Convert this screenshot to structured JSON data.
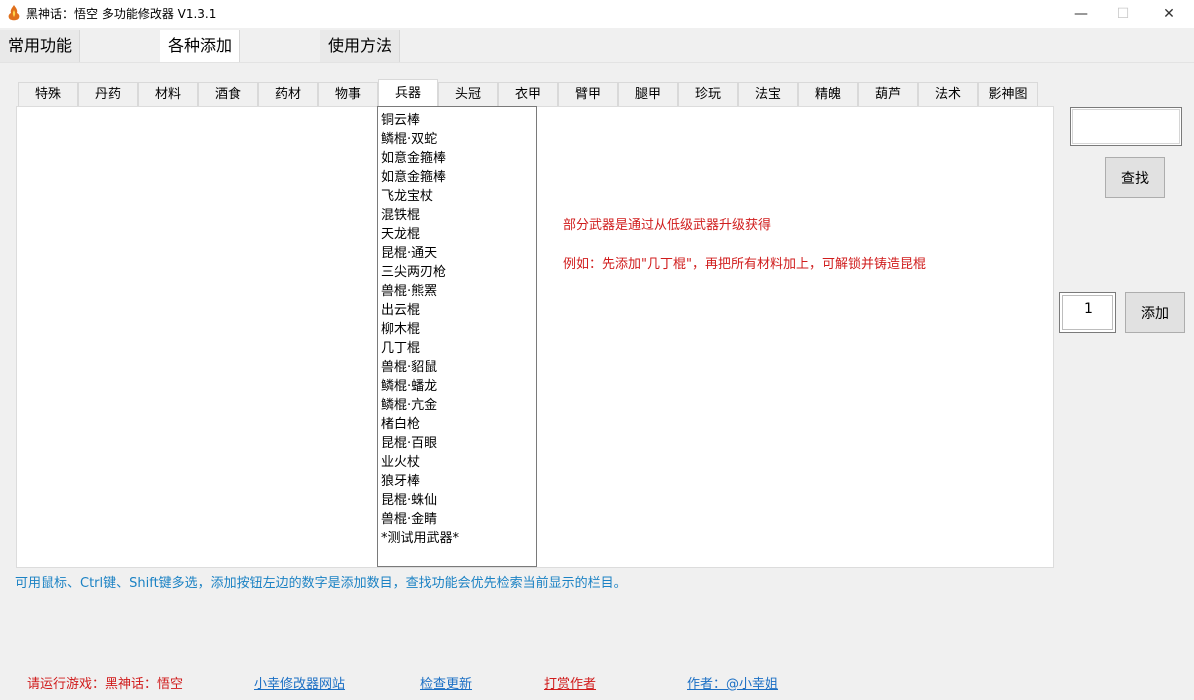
{
  "window": {
    "title": "黑神话：悟空 多功能修改器  V1.3.1",
    "min_glyph": "—",
    "max_glyph": "☐",
    "close_glyph": "✕"
  },
  "main_tabs": [
    {
      "label": "常用功能"
    },
    {
      "label": "各种添加"
    },
    {
      "label": "使用方法"
    }
  ],
  "sub_tabs": [
    {
      "label": "特殊"
    },
    {
      "label": "丹药"
    },
    {
      "label": "材料"
    },
    {
      "label": "酒食"
    },
    {
      "label": "药材"
    },
    {
      "label": "物事"
    },
    {
      "label": "兵器"
    },
    {
      "label": "头冠"
    },
    {
      "label": "衣甲"
    },
    {
      "label": "臂甲"
    },
    {
      "label": "腿甲"
    },
    {
      "label": "珍玩"
    },
    {
      "label": "法宝"
    },
    {
      "label": "精魄"
    },
    {
      "label": "葫芦"
    },
    {
      "label": "法术"
    },
    {
      "label": "影神图"
    }
  ],
  "weapons": [
    "铜云棒",
    "鳞棍·双蛇",
    "如意金箍棒",
    "如意金箍棒",
    "飞龙宝杖",
    "混铁棍",
    "天龙棍",
    "昆棍·通天",
    "三尖两刃枪",
    "兽棍·熊罴",
    "出云棍",
    "柳木棍",
    "几丁棍",
    "兽棍·貂鼠",
    "鳞棍·蟠龙",
    "鳞棍·亢金",
    "楮白枪",
    "昆棍·百眼",
    "业火杖",
    "狼牙棒",
    "昆棍·蛛仙",
    "兽棍·金睛",
    "*测试用武器*"
  ],
  "notes": {
    "line1": "部分武器是通过从低级武器升级获得",
    "line2": "例如：先添加\"几丁棍\"，再把所有材料加上，可解锁并铸造昆棍"
  },
  "controls": {
    "search_value": "",
    "search_button": "查找",
    "count_value": "1",
    "add_button": "添加"
  },
  "hint": "可用鼠标、Ctrl键、Shift键多选，添加按钮左边的数字是添加数目，查找功能会优先检索当前显示的栏目。",
  "footer": {
    "status": "请运行游戏：黑神话：悟空",
    "site_link": "小幸修改器网站",
    "update_link": "检查更新",
    "donate_link": "打赏作者",
    "author_link": "作者：@小幸姐"
  },
  "colors": {
    "note_red": "#d01c1c",
    "hint_blue": "#1b82c4",
    "link_blue": "#1b6fc4"
  }
}
